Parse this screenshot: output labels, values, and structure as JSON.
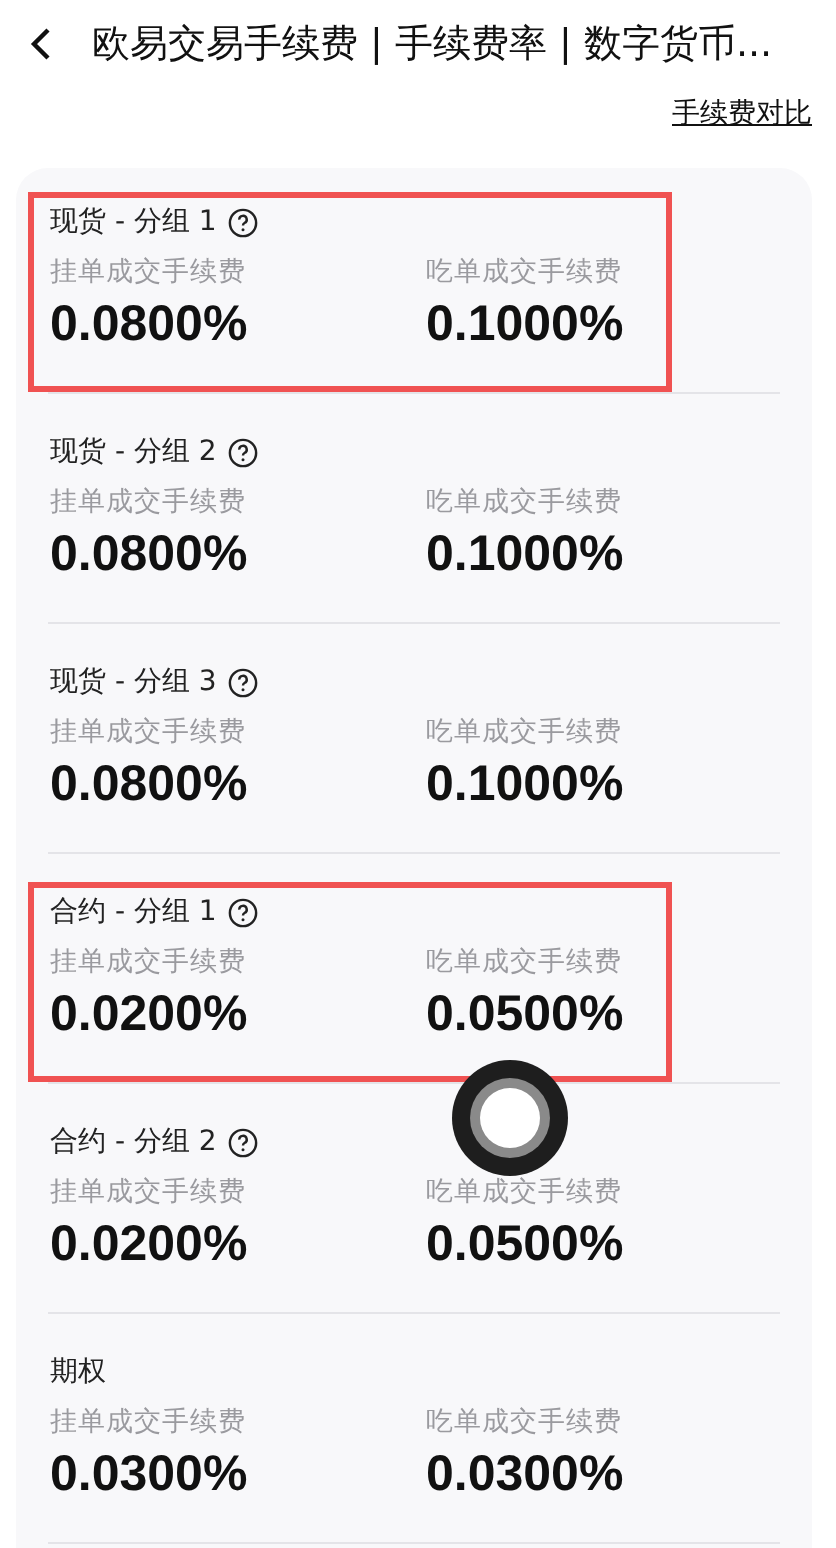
{
  "header": {
    "title": "欧易交易手续费 | 手续费率 | 数字货币..."
  },
  "compare_link": "手续费对比",
  "groups": [
    {
      "title": "现货 - 分组 1",
      "has_help": true,
      "highlighted": true,
      "maker_label": "挂单成交手续费",
      "maker": "0.0800%",
      "taker_label": "吃单成交手续费",
      "taker": "0.1000%"
    },
    {
      "title": "现货 - 分组 2",
      "has_help": true,
      "highlighted": false,
      "maker_label": "挂单成交手续费",
      "maker": "0.0800%",
      "taker_label": "吃单成交手续费",
      "taker": "0.1000%"
    },
    {
      "title": "现货 - 分组 3",
      "has_help": true,
      "highlighted": false,
      "maker_label": "挂单成交手续费",
      "maker": "0.0800%",
      "taker_label": "吃单成交手续费",
      "taker": "0.1000%"
    },
    {
      "title": "合约 - 分组 1",
      "has_help": true,
      "highlighted": true,
      "maker_label": "挂单成交手续费",
      "maker": "0.0200%",
      "taker_label": "吃单成交手续费",
      "taker": "0.0500%"
    },
    {
      "title": "合约 - 分组 2",
      "has_help": true,
      "highlighted": false,
      "maker_label": "挂单成交手续费",
      "maker": "0.0200%",
      "taker_label": "吃单成交手续费",
      "taker": "0.0500%"
    },
    {
      "title": "期权",
      "has_help": false,
      "highlighted": false,
      "maker_label": "挂单成交手续费",
      "maker": "0.0300%",
      "taker_label": "吃单成交手续费",
      "taker": "0.0300%"
    }
  ]
}
